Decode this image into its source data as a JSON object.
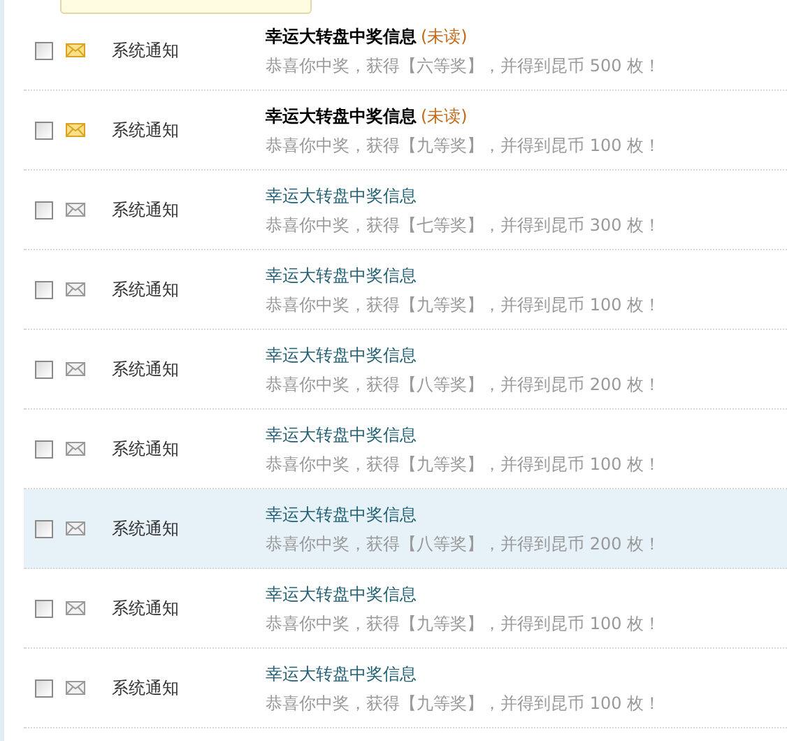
{
  "messages": [
    {
      "checked": false,
      "unread": true,
      "highlighted": false,
      "sender": "系统通知",
      "title": "幸运大转盘中奖信息",
      "unread_label": "(未读)",
      "body": "恭喜你中奖，获得【六等奖】，并得到昆币 500 枚！"
    },
    {
      "checked": false,
      "unread": true,
      "highlighted": false,
      "sender": "系统通知",
      "title": "幸运大转盘中奖信息",
      "unread_label": "(未读)",
      "body": "恭喜你中奖，获得【九等奖】，并得到昆币 100 枚！"
    },
    {
      "checked": false,
      "unread": false,
      "highlighted": false,
      "sender": "系统通知",
      "title": "幸运大转盘中奖信息",
      "body": "恭喜你中奖，获得【七等奖】，并得到昆币 300 枚！"
    },
    {
      "checked": false,
      "unread": false,
      "highlighted": false,
      "sender": "系统通知",
      "title": "幸运大转盘中奖信息",
      "body": "恭喜你中奖，获得【九等奖】，并得到昆币 100 枚！"
    },
    {
      "checked": false,
      "unread": false,
      "highlighted": false,
      "sender": "系统通知",
      "title": "幸运大转盘中奖信息",
      "body": "恭喜你中奖，获得【八等奖】，并得到昆币 200 枚！"
    },
    {
      "checked": false,
      "unread": false,
      "highlighted": false,
      "sender": "系统通知",
      "title": "幸运大转盘中奖信息",
      "body": "恭喜你中奖，获得【九等奖】，并得到昆币 100 枚！"
    },
    {
      "checked": false,
      "unread": false,
      "highlighted": true,
      "sender": "系统通知",
      "title": "幸运大转盘中奖信息",
      "body": "恭喜你中奖，获得【八等奖】，并得到昆币 200 枚！"
    },
    {
      "checked": false,
      "unread": false,
      "highlighted": false,
      "sender": "系统通知",
      "title": "幸运大转盘中奖信息",
      "body": "恭喜你中奖，获得【九等奖】，并得到昆币 100 枚！"
    },
    {
      "checked": false,
      "unread": false,
      "highlighted": false,
      "sender": "系统通知",
      "title": "幸运大转盘中奖信息",
      "body": "恭喜你中奖，获得【九等奖】，并得到昆币 100 枚！"
    }
  ]
}
